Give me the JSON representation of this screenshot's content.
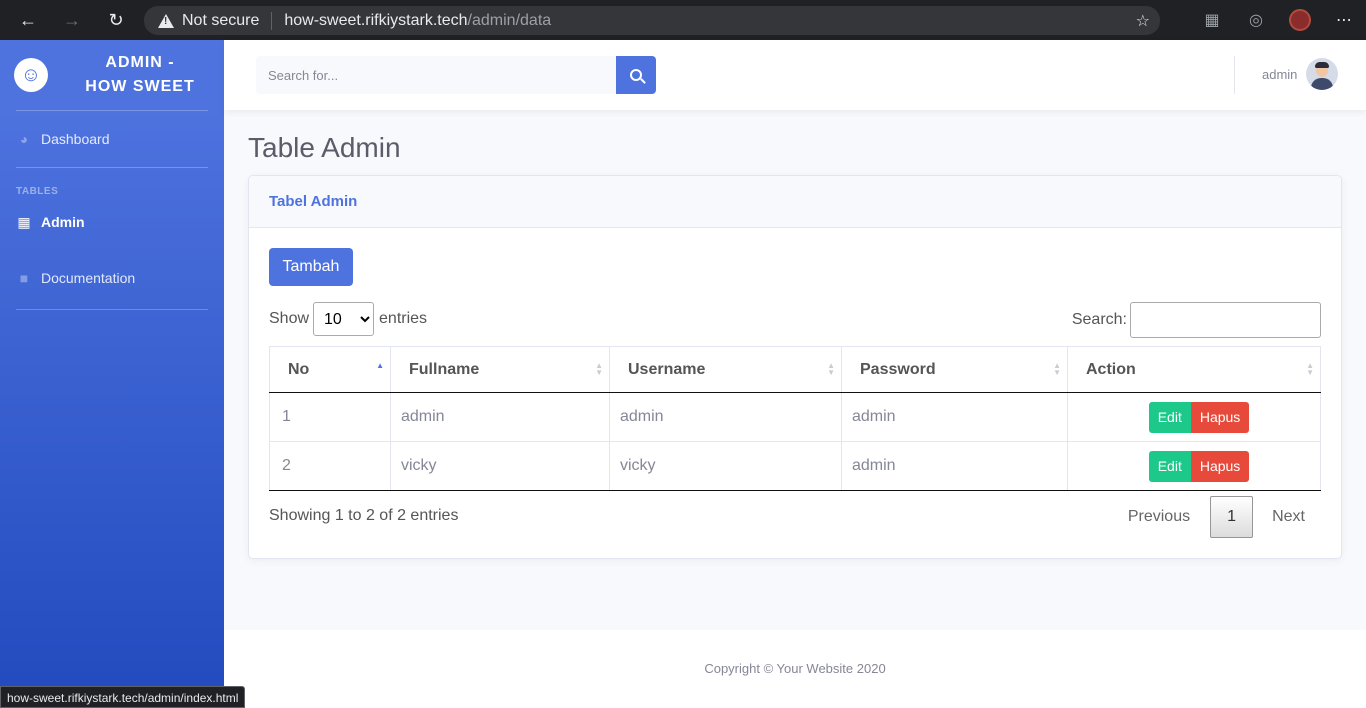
{
  "browser": {
    "security_label": "Not secure",
    "url_host": "how-sweet.rifkiystark.tech",
    "url_path": "/admin/data",
    "status_url": "how-sweet.rifkiystark.tech/admin/index.html"
  },
  "sidebar": {
    "brand_line1": "ADMIN -",
    "brand_line2": "HOW SWEET",
    "brand_icon": "wink-face-icon",
    "heading_tables": "TABLES",
    "items": [
      {
        "label": "Dashboard",
        "icon": "tachometer-icon",
        "active": false
      },
      {
        "label": "Admin",
        "icon": "table-icon",
        "active": true
      },
      {
        "label": "Documentation",
        "icon": "folder-icon",
        "active": false
      }
    ]
  },
  "topbar": {
    "search_placeholder": "Search for...",
    "user_name": "admin"
  },
  "main": {
    "page_title": "Table Admin",
    "card_title": "Tabel Admin",
    "add_button": "Tambah",
    "length_show": "Show",
    "length_value": "10",
    "length_entries": "entries",
    "search_label": "Search:",
    "columns": [
      "No",
      "Fullname",
      "Username",
      "Password",
      "Action"
    ],
    "rows": [
      {
        "no": "1",
        "fullname": "admin",
        "username": "admin",
        "password": "admin"
      },
      {
        "no": "2",
        "fullname": "vicky",
        "username": "vicky",
        "password": "admin"
      }
    ],
    "edit_label": "Edit",
    "delete_label": "Hapus",
    "info": "Showing 1 to 2 of 2 entries",
    "pager": {
      "previous": "Previous",
      "page": "1",
      "next": "Next"
    }
  },
  "footer": {
    "copyright": "Copyright © Your Website 2020"
  },
  "colors": {
    "primary": "#4e73df",
    "success": "#1cc88a",
    "danger": "#e74a3b"
  }
}
